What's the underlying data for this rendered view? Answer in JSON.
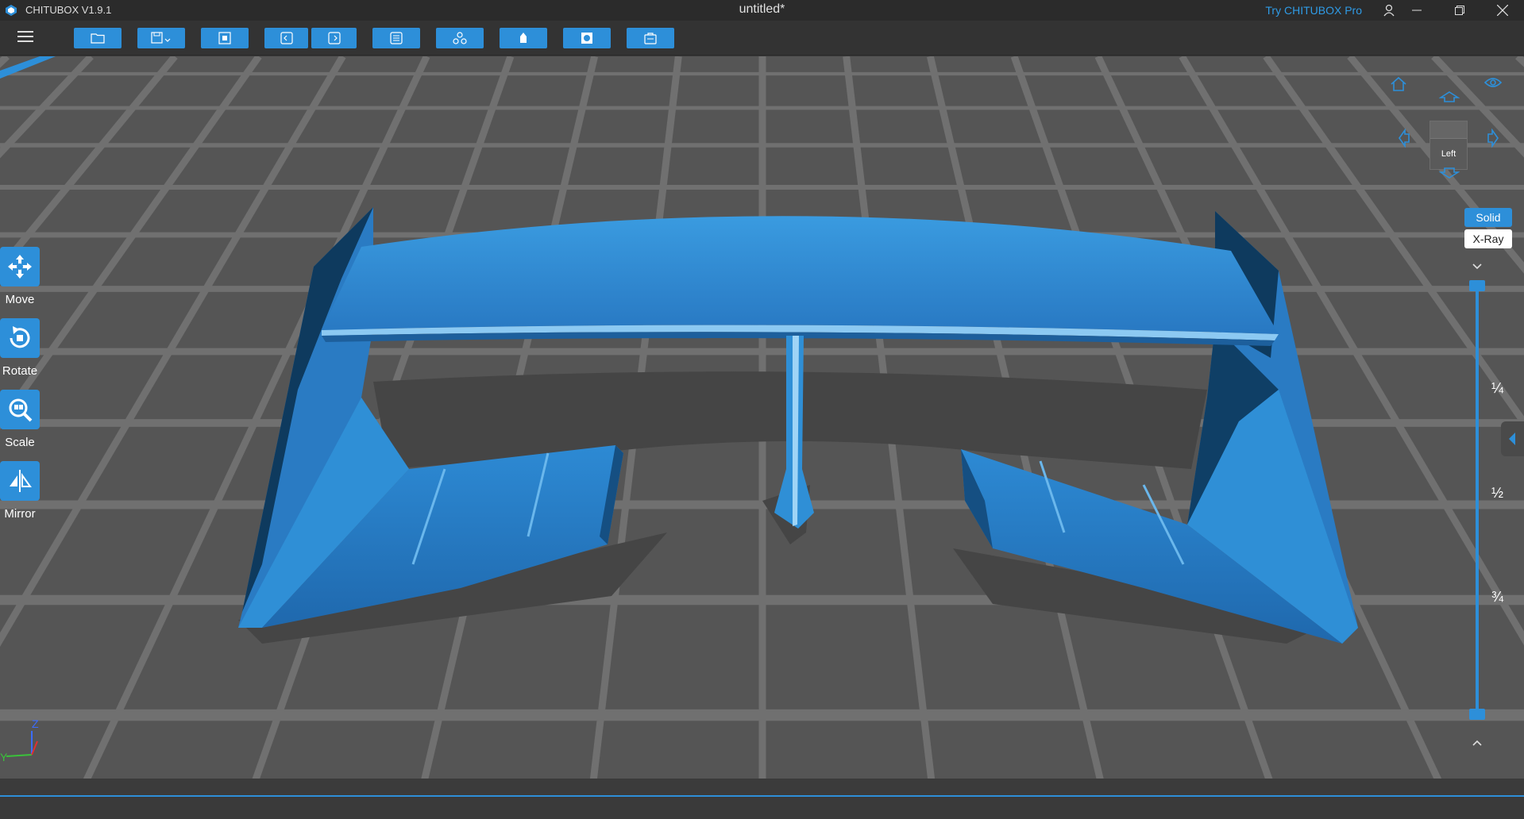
{
  "window": {
    "app_name": "CHITUBOX V1.9.1",
    "document_title": "untitled*",
    "try_pro": "Try CHITUBOX Pro"
  },
  "toolbar": {
    "buttons": [
      {
        "name": "open-file",
        "icon": "folder-icon"
      },
      {
        "name": "save",
        "icon": "save-icon"
      },
      {
        "name": "fit-view",
        "icon": "frame-icon"
      },
      {
        "name": "undo",
        "icon": "undo-icon"
      },
      {
        "name": "redo",
        "icon": "redo-icon"
      },
      {
        "name": "model-list",
        "icon": "list-icon"
      },
      {
        "name": "auto-layout",
        "icon": "arrange-icon"
      },
      {
        "name": "supports",
        "icon": "support-icon"
      },
      {
        "name": "hollow",
        "icon": "hollow-icon"
      },
      {
        "name": "slice",
        "icon": "slice-icon"
      }
    ]
  },
  "tools": [
    {
      "label": "Move",
      "icon": "move-icon"
    },
    {
      "label": "Rotate",
      "icon": "rotate-icon"
    },
    {
      "label": "Scale",
      "icon": "scale-icon"
    },
    {
      "label": "Mirror",
      "icon": "mirror-icon"
    }
  ],
  "viewcube": {
    "face_label": "Left"
  },
  "render_mode": {
    "solid": "Solid",
    "xray": "X-Ray",
    "selected": "Solid"
  },
  "layer_slider": {
    "ticks": [
      "¼",
      "½",
      "¾"
    ],
    "range_low": 0,
    "range_high": 1
  },
  "axes": {
    "x": "Y",
    "z": "Z"
  },
  "colors": {
    "accent": "#2d8fd9",
    "model": "#2f8fd6",
    "grid_line": "#6f6f6f",
    "plate": "#555555",
    "background": "#3b3b3b"
  }
}
